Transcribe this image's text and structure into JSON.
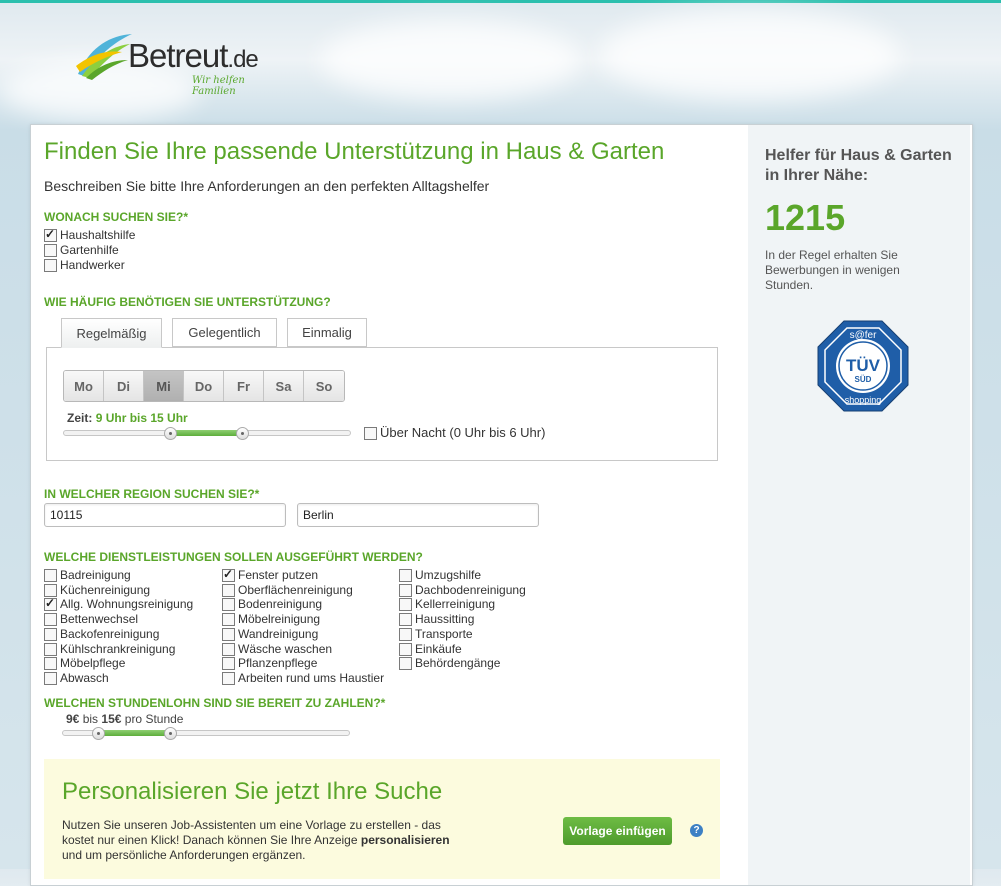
{
  "brand": {
    "name": "Betreut",
    "tld": ".de",
    "tagline": "Wir helfen Familien"
  },
  "form": {
    "title": "Finden Sie Ihre passende Unterstützung in Haus & Garten",
    "subtitle": "Beschreiben Sie bitte Ihre Anforderungen an den perfekten Alltagshelfer",
    "search_section": {
      "label": "WONACH SUCHEN SIE?*",
      "options": [
        {
          "label": "Haushaltshilfe",
          "checked": true
        },
        {
          "label": "Gartenhilfe",
          "checked": false
        },
        {
          "label": "Handwerker",
          "checked": false
        }
      ]
    },
    "frequency_section": {
      "label": "WIE HÄUFIG BENÖTIGEN SIE UNTERSTÜTZUNG?",
      "tabs": [
        "Regelmäßig",
        "Gelegentlich",
        "Einmalig"
      ],
      "active_tab": "Regelmäßig",
      "days": [
        "Mo",
        "Di",
        "Mi",
        "Do",
        "Fr",
        "Sa",
        "So"
      ],
      "active_day": "Mi",
      "time_label": "Zeit:",
      "time_value": "9 Uhr bis 15 Uhr",
      "time_range": [
        9,
        15
      ],
      "overnight_label": "Über Nacht (0 Uhr bis 6 Uhr)",
      "overnight_checked": false
    },
    "region_section": {
      "label": "IN WELCHER REGION SUCHEN SIE?*",
      "postal_code": "10115",
      "city": "Berlin"
    },
    "services_section": {
      "label": "WELCHE DIENSTLEISTUNGEN SOLLEN AUSGEFÜHRT WERDEN?",
      "columns": [
        [
          {
            "label": "Badreinigung",
            "checked": false
          },
          {
            "label": "Küchenreinigung",
            "checked": false
          },
          {
            "label": "Allg. Wohnungsreinigung",
            "checked": true
          },
          {
            "label": "Bettenwechsel",
            "checked": false
          },
          {
            "label": "Backofenreinigung",
            "checked": false
          },
          {
            "label": "Kühlschrankreinigung",
            "checked": false
          },
          {
            "label": "Möbelpflege",
            "checked": false
          },
          {
            "label": "Abwasch",
            "checked": false
          }
        ],
        [
          {
            "label": "Fenster putzen",
            "checked": true
          },
          {
            "label": "Oberflächenreinigung",
            "checked": false
          },
          {
            "label": "Bodenreinigung",
            "checked": false
          },
          {
            "label": "Möbelreinigung",
            "checked": false
          },
          {
            "label": "Wandreinigung",
            "checked": false
          },
          {
            "label": "Wäsche waschen",
            "checked": false
          },
          {
            "label": "Pflanzenpflege",
            "checked": false
          },
          {
            "label": "Arbeiten rund ums Haustier",
            "checked": false
          }
        ],
        [
          {
            "label": "Umzugshilfe",
            "checked": false
          },
          {
            "label": "Dachbodenreinigung",
            "checked": false
          },
          {
            "label": "Kellerreinigung",
            "checked": false
          },
          {
            "label": "Haussitting",
            "checked": false
          },
          {
            "label": "Transporte",
            "checked": false
          },
          {
            "label": "Einkäufe",
            "checked": false
          },
          {
            "label": "Behördengänge",
            "checked": false
          }
        ]
      ]
    },
    "wage_section": {
      "label": "WELCHEN STUNDENLOHN SIND SIE BEREIT ZU ZAHLEN?*",
      "min_text": "9€",
      "between_text": "bis",
      "max_text": "15€",
      "unit_text": "pro Stunde",
      "range": [
        9,
        15
      ]
    }
  },
  "promo": {
    "title": "Personalisieren Sie jetzt Ihre Suche",
    "text_part1": "Nutzen Sie unseren Job-Assistenten um eine Vorlage zu erstellen - das kostet nur einen Klick! Danach können Sie Ihre Anzeige ",
    "text_bold": "personalisieren",
    "text_part2": " und um persönliche Anforderungen ergänzen.",
    "button_label": "Vorlage einfügen",
    "help_label": "?"
  },
  "sidebar": {
    "title": "Helfer für Haus & Garten in Ihrer Nähe:",
    "count": "1215",
    "text": "In der Regel erhalten Sie Bewerbungen in wenigen Stunden.",
    "badge": {
      "top": "s@fer",
      "main": "TÜV",
      "sub": "SÜD",
      "bottom": "shopping"
    }
  },
  "colors": {
    "accent_green": "#5aa62a",
    "top_bar": "#2bbfae",
    "promo_bg": "#fcfbde",
    "tuv_blue": "#1f5ea8"
  }
}
